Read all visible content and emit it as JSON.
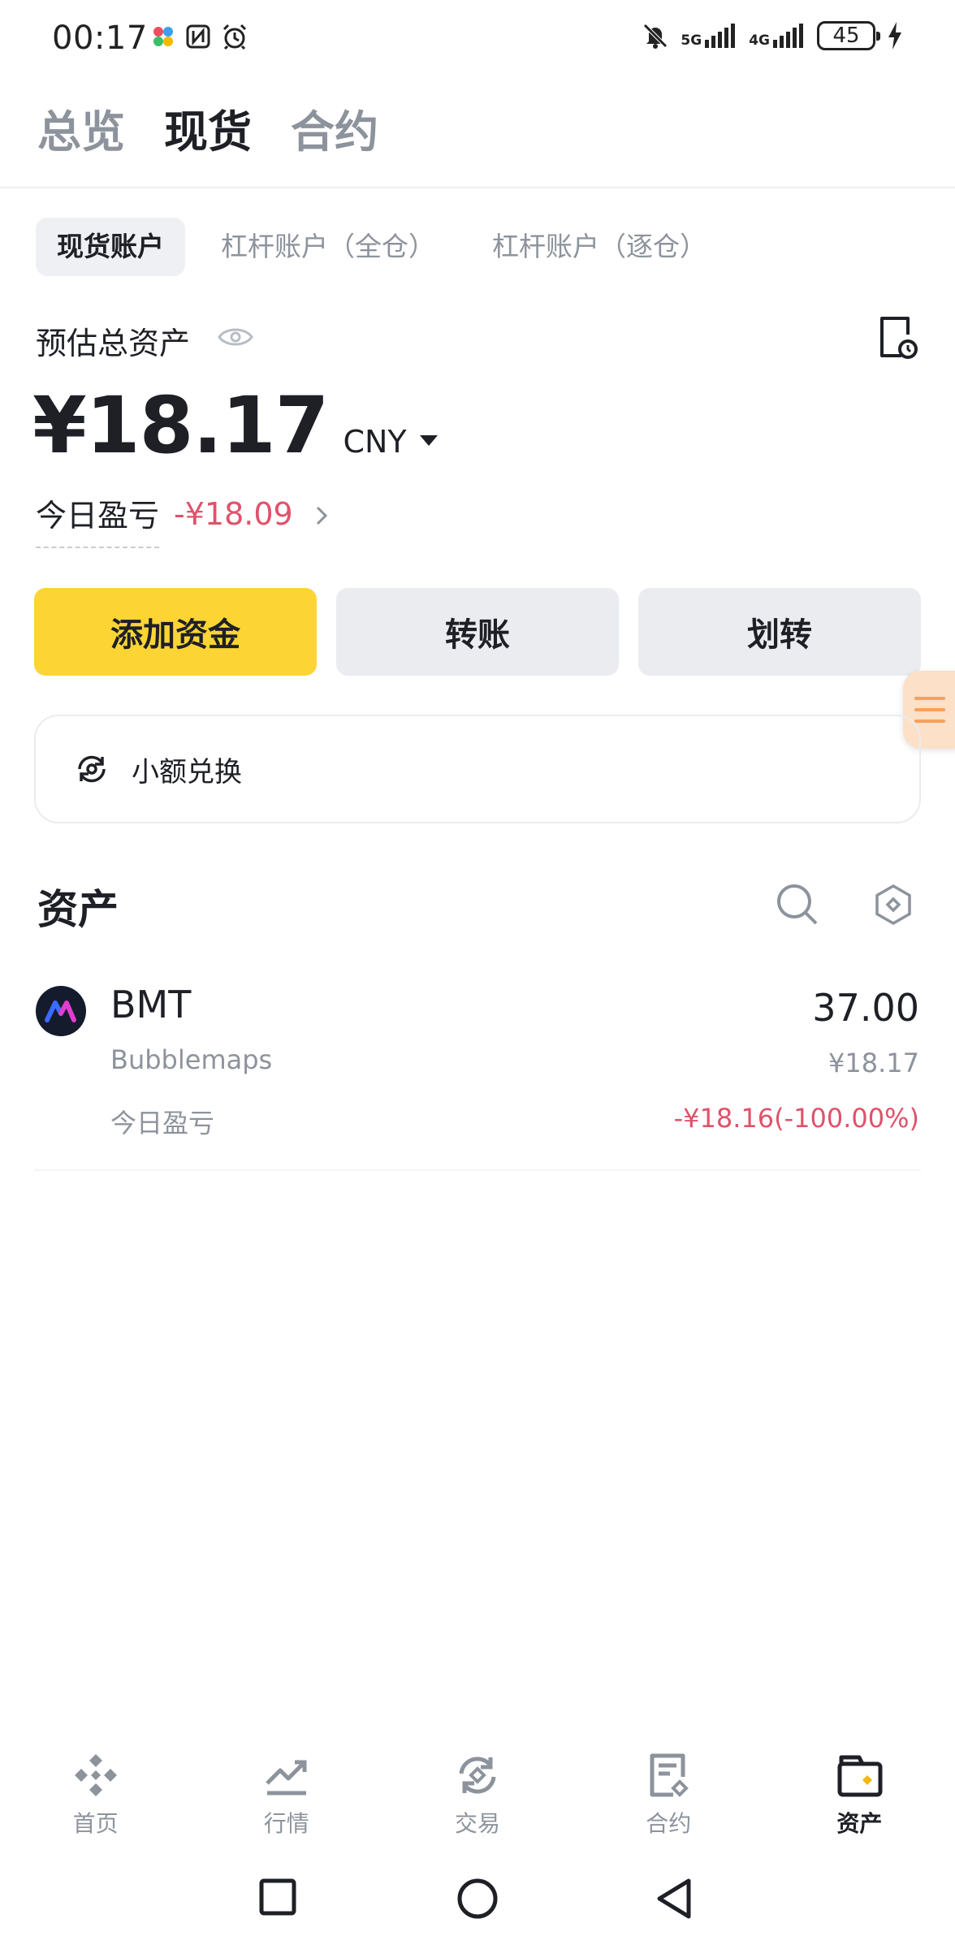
{
  "status_bar": {
    "time": "00:17",
    "net1": "5G",
    "net2": "4G",
    "battery": "45"
  },
  "top_tabs": [
    {
      "label": "总览",
      "active": false
    },
    {
      "label": "现货",
      "active": true
    },
    {
      "label": "合约",
      "active": false
    }
  ],
  "account_tabs": [
    {
      "label": "现货账户",
      "active": true
    },
    {
      "label": "杠杆账户（全仓）",
      "active": false
    },
    {
      "label": "杠杆账户（逐仓）",
      "active": false
    }
  ],
  "estimate": {
    "label": "预估总资产",
    "amount": "¥18.17",
    "unit": "CNY",
    "pnl_label": "今日盈亏",
    "pnl_value": "-¥18.09"
  },
  "actions": {
    "add_funds": "添加资金",
    "transfer": "转账",
    "internal_transfer": "划转"
  },
  "dust_convert": {
    "label": "小额兑换"
  },
  "assets": {
    "title": "资产",
    "items": [
      {
        "symbol": "BMT",
        "name": "Bubblemaps",
        "amount": "37.00",
        "value": "¥18.17",
        "pnl_label": "今日盈亏",
        "pnl": "-¥18.16(-100.00%)"
      }
    ]
  },
  "bottom_nav": [
    {
      "label": "首页",
      "icon": "home-icon",
      "active": false
    },
    {
      "label": "行情",
      "icon": "markets-icon",
      "active": false
    },
    {
      "label": "交易",
      "icon": "trade-icon",
      "active": false
    },
    {
      "label": "合约",
      "icon": "futures-icon",
      "active": false
    },
    {
      "label": "资产",
      "icon": "wallet-icon",
      "active": true
    }
  ],
  "colors": {
    "accent": "#fcd535",
    "negative": "#e0526a",
    "muted": "#8d939c"
  }
}
